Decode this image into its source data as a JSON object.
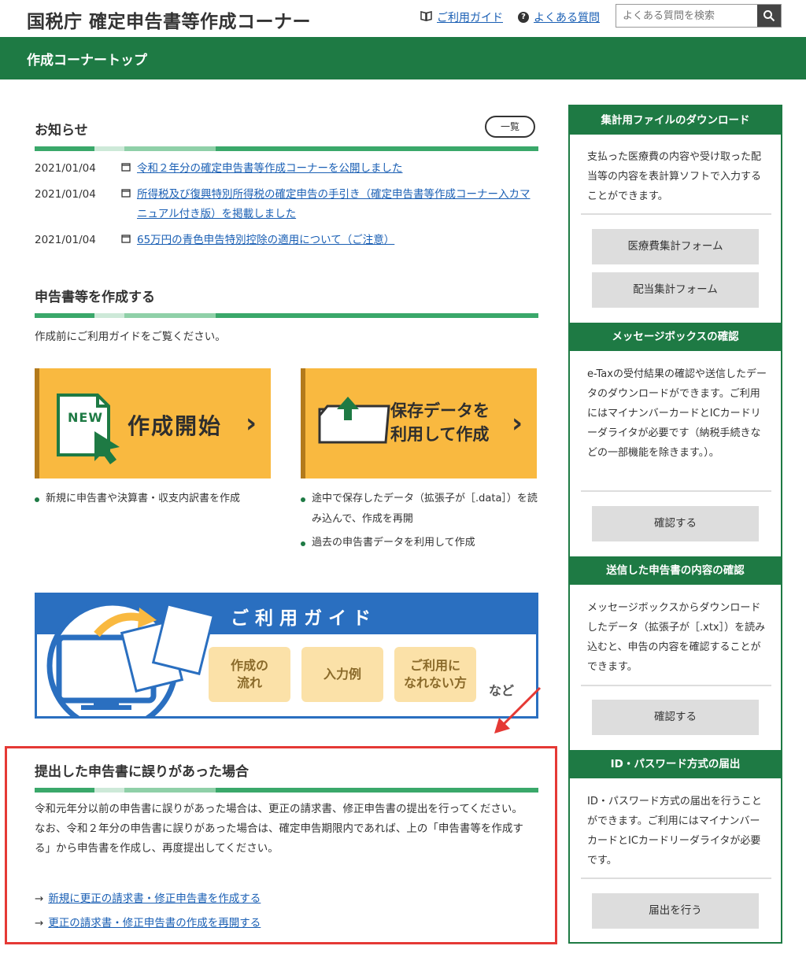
{
  "header": {
    "site_title": "国税庁 確定申告書等作成コーナー",
    "guide_link": "ご利用ガイド",
    "faq_link": "よくある質問",
    "search_placeholder": "よくある質問を検索"
  },
  "navbar": {
    "title": "作成コーナートップ"
  },
  "news": {
    "title": "お知らせ",
    "list_button": "一覧",
    "items": [
      {
        "date": "2021/01/04",
        "text": "令和２年分の確定申告書等作成コーナーを公開しました"
      },
      {
        "date": "2021/01/04",
        "text": "所得税及び復興特別所得税の確定申告の手引き（確定申告書等作成コーナー入カマニュアル付き版）を掲載しました"
      },
      {
        "date": "2021/01/04",
        "text": "65万円の青色申告特別控除の適用について（ご注意）"
      }
    ]
  },
  "create": {
    "title": "申告書等を作成する",
    "note": "作成前にご利用ガイドをご覧ください。",
    "card_new": {
      "badge": "NEW",
      "label": "作成開始",
      "desc": [
        "新規に申告書や決算書・収支内訳書を作成"
      ]
    },
    "card_saved": {
      "label_line1": "保存データを",
      "label_line2": "利用して作成",
      "desc": [
        "途中で保存したデータ（拡張子が［.data］）を読み込んで、作成を再開",
        "過去の申告書データを利用して作成"
      ]
    }
  },
  "guide_banner": {
    "title": "ご利用ガイド",
    "pills": [
      {
        "line1": "作成の",
        "line2": "流れ"
      },
      {
        "line1": "入力例",
        "line2": ""
      },
      {
        "line1": "ご利用に",
        "line2": "なれない方"
      }
    ],
    "etc": "など"
  },
  "error_section": {
    "title": "提出した申告書に誤りがあった場合",
    "para1": "令和元年分以前の申告書に誤りがあった場合は、更正の請求書、修正申告書の提出を行ってください。",
    "para2": "なお、令和２年分の申告書に誤りがあった場合は、確定申告期限内であれば、上の「申告書等を作成する」から申告書を作成し、再度提出してください。",
    "link1": "新規に更正の請求書・修正申告書を作成する",
    "link2": "更正の請求書・修正申告書の作成を再開する"
  },
  "sidebar": {
    "download": {
      "head": "集計用ファイルのダウンロード",
      "text": "支払った医療費の内容や受け取った配当等の内容を表計算ソフトで入力することができます。",
      "btn1": "医療費集計フォーム",
      "btn2": "配当集計フォーム"
    },
    "messagebox": {
      "head": "メッセージボックスの確認",
      "text": "e-Taxの受付結果の確認や送信したデータのダウンロードができます。ご利用にはマイナンバーカードとICカードリーダライタが必要です（納税手続きなどの一部機能を除きます。）。",
      "btn": "確認する"
    },
    "sent": {
      "head": "送信した申告書の内容の確認",
      "text": "メッセージボックスからダウンロードしたデータ（拡張子が［.xtx］）を読み込むと、申告の内容を確認することができます。",
      "btn": "確認する"
    },
    "idpw": {
      "head": "ID・パスワード方式の届出",
      "text": "ID・パスワード方式の届出を行うことができます。ご利用にはマイナンバーカードとICカードリーダライタが必要です。",
      "btn": "届出を行う"
    }
  },
  "colors": {
    "green": "#1e7a44",
    "orange": "#f9b940",
    "blue": "#2a6fc0",
    "red": "#e53935"
  }
}
